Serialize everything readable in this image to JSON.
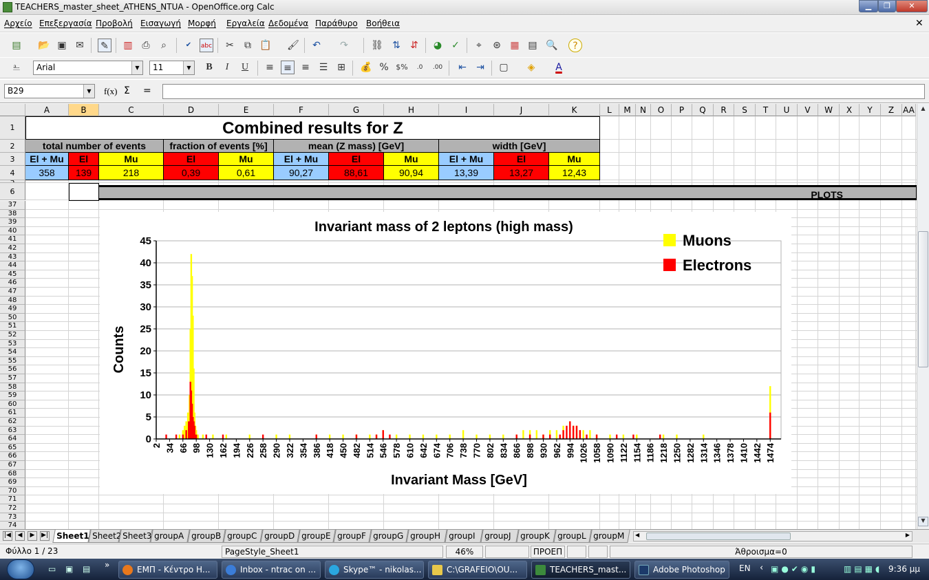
{
  "window": {
    "title": "TEACHERS_master_sheet_ATHENS_NTUA - OpenOffice.org Calc"
  },
  "menu": [
    "Αρχείο",
    "Επεξεργασία",
    "Προβολή",
    "Εισαγωγή",
    "Μορφή",
    "Εργαλεία",
    "Δεδομένα",
    "Παράθυρο",
    "Βοήθεια"
  ],
  "format_bar": {
    "font_name": "Arial",
    "font_size": "11"
  },
  "formula_bar": {
    "name_box": "B29",
    "function_label": "f(x)",
    "sum_label": "Σ",
    "equals_label": "=",
    "content": ""
  },
  "columns": [
    "A",
    "B",
    "C",
    "D",
    "E",
    "F",
    "G",
    "H",
    "I",
    "J",
    "K",
    "L",
    "M",
    "N",
    "O",
    "P",
    "Q",
    "R",
    "S",
    "T",
    "U",
    "V",
    "W",
    "X",
    "Y",
    "Z",
    "AA"
  ],
  "rows_top": [
    "1",
    "2",
    "3",
    "4",
    "5",
    "6"
  ],
  "rows_bottom": [
    "37",
    "38",
    "39",
    "40",
    "41",
    "42",
    "43",
    "44",
    "45",
    "46",
    "47",
    "48",
    "49",
    "50",
    "51",
    "52",
    "53",
    "54",
    "55",
    "56",
    "57",
    "58",
    "59",
    "60",
    "61",
    "62",
    "63",
    "64",
    "65",
    "66",
    "67",
    "68",
    "69",
    "70",
    "71",
    "72",
    "73",
    "74"
  ],
  "sheet": {
    "title": "Combined results for Z",
    "group_headers": [
      "total number of events",
      "fraction of events [%]",
      "mean (Z mass) [GeV]",
      "width [GeV]"
    ],
    "sub_headers": [
      "El + Mu",
      "El",
      "Mu",
      "El",
      "Mu",
      "El + Mu",
      "El",
      "Mu",
      "El + Mu",
      "El",
      "Mu"
    ],
    "values": [
      "358",
      "139",
      "218",
      "0,39",
      "0,61",
      "90,27",
      "88,61",
      "90,94",
      "13,39",
      "13,27",
      "12,43"
    ],
    "plots_label": "PLOTS"
  },
  "colors": {
    "blue": "#99ccff",
    "red": "#ff0000",
    "yellow": "#ffff00",
    "gray": "#b2b2b2",
    "muons": "#ffff00",
    "electrons": "#ff0000"
  },
  "chart_data": {
    "type": "bar",
    "title": "Invariant mass of 2 leptons (high mass)",
    "xlabel": "Invariant Mass [GeV]",
    "ylabel": "Counts",
    "ylim": [
      0,
      45
    ],
    "yticks": [
      0,
      5,
      10,
      15,
      20,
      25,
      30,
      35,
      40,
      45
    ],
    "xticks": [
      "2",
      "34",
      "66",
      "98",
      "130",
      "162",
      "194",
      "226",
      "258",
      "290",
      "322",
      "354",
      "386",
      "418",
      "450",
      "482",
      "514",
      "546",
      "578",
      "610",
      "642",
      "674",
      "706",
      "738",
      "770",
      "802",
      "834",
      "866",
      "898",
      "930",
      "962",
      "994",
      "1026",
      "1058",
      "1090",
      "1122",
      "1154",
      "1186",
      "1218",
      "1250",
      "1282",
      "1314",
      "1346",
      "1378",
      "1410",
      "1442",
      "1474"
    ],
    "legend_position": "top-right",
    "grid": "horizontal",
    "series": [
      {
        "name": "Muons",
        "color": "#ffff00",
        "points": [
          [
            58,
            1
          ],
          [
            66,
            2
          ],
          [
            70,
            3
          ],
          [
            74,
            4
          ],
          [
            78,
            6
          ],
          [
            82,
            10
          ],
          [
            84,
            25
          ],
          [
            86,
            42
          ],
          [
            88,
            37
          ],
          [
            90,
            28
          ],
          [
            92,
            16
          ],
          [
            94,
            6
          ],
          [
            96,
            3
          ],
          [
            98,
            2
          ],
          [
            102,
            1
          ],
          [
            114,
            1
          ],
          [
            138,
            1
          ],
          [
            170,
            1
          ],
          [
            226,
            1
          ],
          [
            290,
            1
          ],
          [
            322,
            1
          ],
          [
            386,
            1
          ],
          [
            418,
            1
          ],
          [
            450,
            1
          ],
          [
            482,
            1
          ],
          [
            514,
            1
          ],
          [
            530,
            1
          ],
          [
            546,
            2
          ],
          [
            578,
            1
          ],
          [
            610,
            1
          ],
          [
            642,
            1
          ],
          [
            674,
            1
          ],
          [
            706,
            1
          ],
          [
            738,
            2
          ],
          [
            770,
            1
          ],
          [
            802,
            1
          ],
          [
            834,
            1
          ],
          [
            866,
            1
          ],
          [
            882,
            2
          ],
          [
            898,
            2
          ],
          [
            914,
            2
          ],
          [
            930,
            1
          ],
          [
            946,
            2
          ],
          [
            962,
            2
          ],
          [
            978,
            3
          ],
          [
            994,
            4
          ],
          [
            1002,
            3
          ],
          [
            1010,
            3
          ],
          [
            1018,
            2
          ],
          [
            1026,
            2
          ],
          [
            1042,
            2
          ],
          [
            1058,
            1
          ],
          [
            1090,
            1
          ],
          [
            1122,
            1
          ],
          [
            1154,
            1
          ],
          [
            1218,
            1
          ],
          [
            1250,
            1
          ],
          [
            1314,
            1
          ],
          [
            1474,
            12
          ]
        ]
      },
      {
        "name": "Electrons",
        "color": "#ff0000",
        "points": [
          [
            26,
            1
          ],
          [
            50,
            1
          ],
          [
            66,
            1
          ],
          [
            74,
            2
          ],
          [
            80,
            4
          ],
          [
            84,
            13
          ],
          [
            86,
            11
          ],
          [
            88,
            8
          ],
          [
            90,
            5
          ],
          [
            92,
            4
          ],
          [
            94,
            3
          ],
          [
            98,
            1
          ],
          [
            122,
            1
          ],
          [
            162,
            1
          ],
          [
            258,
            1
          ],
          [
            386,
            1
          ],
          [
            482,
            1
          ],
          [
            530,
            1
          ],
          [
            546,
            2
          ],
          [
            562,
            1
          ],
          [
            866,
            1
          ],
          [
            898,
            1
          ],
          [
            930,
            1
          ],
          [
            946,
            1
          ],
          [
            970,
            1
          ],
          [
            978,
            2
          ],
          [
            986,
            3
          ],
          [
            994,
            4
          ],
          [
            1002,
            3
          ],
          [
            1010,
            3
          ],
          [
            1018,
            2
          ],
          [
            1034,
            1
          ],
          [
            1058,
            1
          ],
          [
            1106,
            1
          ],
          [
            1146,
            1
          ],
          [
            1210,
            1
          ],
          [
            1474,
            6
          ]
        ]
      }
    ]
  },
  "tabs": [
    "Sheet1",
    "Sheet2",
    "Sheet3",
    "groupA",
    "groupB",
    "groupC",
    "groupD",
    "groupE",
    "groupF",
    "groupG",
    "groupH",
    "groupI",
    "groupJ",
    "groupK",
    "groupL",
    "groupM"
  ],
  "status": {
    "sheet": "Φύλλο 1 / 23",
    "page_style": "PageStyle_Sheet1",
    "zoom": "46%",
    "mode": "ΠΡΟΕΠ",
    "sum": "Άθροισμα=0"
  },
  "taskbar": {
    "items": [
      "ΕΜΠ - Κέντρο Η...",
      "Inbox - ntrac on ...",
      "Skype™ - nikolas...",
      "C:\\GRAFEIO\\OU...",
      "TEACHERS_mast...",
      "Adobe Photoshop"
    ],
    "lang": "EN",
    "time": "9:36 μμ"
  }
}
